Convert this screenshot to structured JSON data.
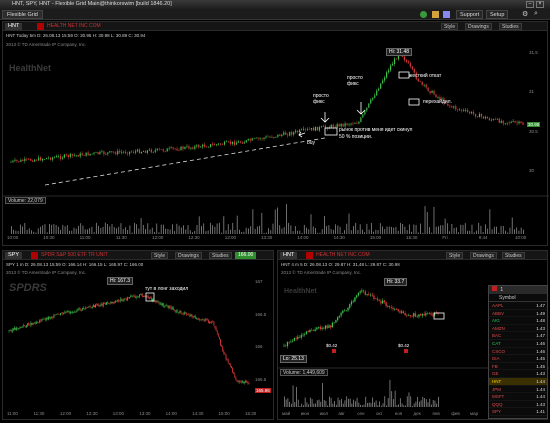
{
  "window": {
    "title": "HNT, SPY, HNT - Flexible Grid Main@thinkorswim [build 1846.20]"
  },
  "toolbar": {
    "tab_label": "Flexible Grid",
    "support_label": "Support",
    "setup_label": "Setup"
  },
  "common": {
    "style": "Style",
    "drawings": "Drawings",
    "studies": "Studies"
  },
  "main_chart": {
    "symbol": "HNT",
    "name": "HEALTH NET INC COM",
    "quote": "HNT Today 5m  D: 26.08.13 15:59  O: 30.95  H: 30.98  L: 30.89  C: 30.94",
    "copyright": "2013 © TD Ameritrade IP Company, Inc.",
    "watermark": "HealthNet",
    "hi_label": "Hi: 31.48",
    "volume_label": "Volume: 22,079",
    "price_box": "30.98",
    "price_box_color": "#2f8f2f",
    "ticks_y": [
      "31.5",
      "31",
      "30.5",
      "30"
    ],
    "ticks_x": [
      "10:00",
      "10:30",
      "11:00",
      "11:30",
      "12:00",
      "12:30",
      "13:00",
      "13:30",
      "14:00",
      "14:30",
      "15:00",
      "15:30",
      "Fri",
      "9:44",
      "10:00"
    ],
    "annotations": {
      "fix1": "просто фикс",
      "fix2": "просто фикс",
      "hard_stop": "жесткий откат",
      "overshoot": "перехайдил.",
      "market_against": "рынок против меня идет скинул 50 % позиции.",
      "buy": "buy"
    }
  },
  "spy_chart": {
    "symbol": "SPY",
    "name": "SPDR S&P 500 ETF TR UNIT",
    "price": "166.00",
    "price_color": "#2f8f2f",
    "quote": "SPY 1 m D: 26.08.13 15:59  O: 166.14  H: 166.15  L: 165.97  C: 166.00",
    "copyright": "2013 © TD Ameritrade IP Company, Inc.",
    "watermark": "SPDRS",
    "hi_label": "Hi: 167.3",
    "annotation": "тут в лонг заходил",
    "price_box": "165.96",
    "ticks_y": [
      "167",
      "166.5",
      "166",
      "165.5"
    ],
    "ticks_x": [
      "11:00",
      "11:30",
      "12:00",
      "12:30",
      "13:00",
      "13:30",
      "14:00",
      "14:30",
      "15:00",
      "15:30"
    ]
  },
  "hnt_small": {
    "symbol": "HNT",
    "name": "HEALTH NET INC COM",
    "quote": "HNT 4 m 5  D: 26.08.13  O: 29.87  H: 31.48  L: 29.87  C: 30.98",
    "copyright": "2013 © TD Ameritrade IP Company, Inc.",
    "watermark": "HealthNet",
    "hi_label": "Hi: 33.7",
    "lo_label": "Lo: 25.13",
    "earnings1": "$0.42",
    "earnings2": "$0.42",
    "volume_label": "Volume: 1,449,609",
    "ticks_x": [
      "май",
      "июн",
      "июл",
      "авг",
      "сен",
      "окт",
      "ноя",
      "дек",
      "янв",
      "фев",
      "мар"
    ]
  },
  "watchlist": {
    "title": "1",
    "column": "Symbol",
    "rows": [
      {
        "sym": "AAPL",
        "price": "1.47",
        "color": "#e14b4b"
      },
      {
        "sym": "ABBV",
        "price": "1.49",
        "color": "#e14b4b"
      },
      {
        "sym": "AIG",
        "price": "1.48",
        "color": "#22c65a"
      },
      {
        "sym": "AMZN",
        "price": "1.43",
        "color": "#e14b4b"
      },
      {
        "sym": "BAC",
        "price": "1.47",
        "color": "#e14b4b"
      },
      {
        "sym": "CAT",
        "price": "1.46",
        "color": "#22c65a"
      },
      {
        "sym": "CSCO",
        "price": "1.46",
        "color": "#e14b4b"
      },
      {
        "sym": "DIA",
        "price": "1.45",
        "color": "#e14b4b"
      },
      {
        "sym": "FB",
        "price": "1.45",
        "color": "#e14b4b"
      },
      {
        "sym": "GE",
        "price": "1.43",
        "color": "#e14b4b"
      },
      {
        "sym": "HNT",
        "price": "1.44",
        "color": "#ffcc00"
      },
      {
        "sym": "JPM",
        "price": "1.44",
        "color": "#e14b4b"
      },
      {
        "sym": "MSFT",
        "price": "1.44",
        "color": "#e14b4b"
      },
      {
        "sym": "QQQ",
        "price": "1.43",
        "color": "#e14b4b"
      },
      {
        "sym": "SPY",
        "price": "1.41",
        "color": "#e14b4b"
      }
    ]
  },
  "statusbar": {
    "label": "Setup"
  }
}
